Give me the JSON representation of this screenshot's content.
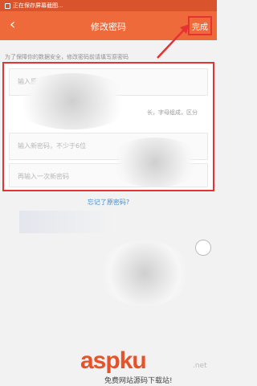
{
  "status_bar": {
    "text": "正在保存屏幕截图..."
  },
  "header": {
    "back_icon": "chevron-left-icon",
    "title": "修改密码",
    "done_label": "完成"
  },
  "hint": "为了保障你的数据安全，修改密码前请填写原密码",
  "form": {
    "old_password_placeholder": "输入原密码",
    "rule_text": "长，字母组成，区分",
    "new_password_placeholder": "输入新密码，不少于6位",
    "confirm_password_placeholder": "再输入一次新密码"
  },
  "forgot_link": "忘记了原密码?",
  "watermark": {
    "brand": "aspku",
    "tld": ".net",
    "subtitle": "免费网站源码下载站!"
  },
  "colors": {
    "header": "#ef6a3a",
    "statusbar": "#d9532c",
    "annotation": "#e53333",
    "link": "#3b8fd9"
  }
}
